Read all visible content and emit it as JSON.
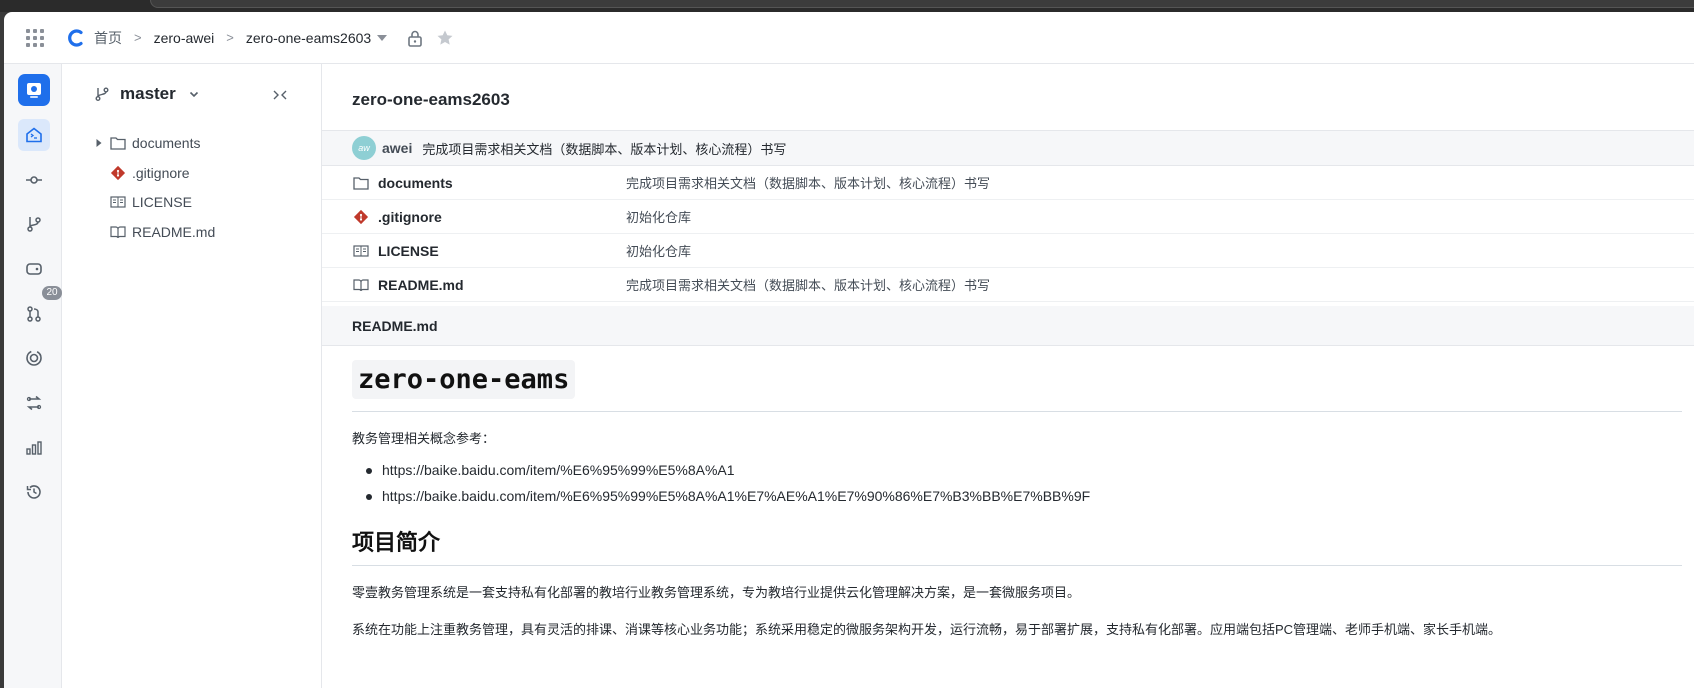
{
  "header": {
    "breadcrumb": {
      "home": "首页",
      "org": "zero-awei",
      "repo": "zero-one-eams2603"
    }
  },
  "rail": {
    "items": [
      {
        "icon": "repo-home-icon",
        "active": true
      },
      {
        "icon": "commits-icon"
      },
      {
        "icon": "branches-icon",
        "badge": "20"
      },
      {
        "icon": "tags-icon"
      },
      {
        "icon": "merge-requests-icon"
      },
      {
        "icon": "pipelines-icon"
      },
      {
        "icon": "compare-icon"
      },
      {
        "icon": "statistics-icon"
      },
      {
        "icon": "history-icon"
      }
    ]
  },
  "tree": {
    "branch": "master",
    "items": [
      {
        "name": "documents",
        "type": "folder"
      },
      {
        "name": ".gitignore",
        "type": "git"
      },
      {
        "name": "LICENSE",
        "type": "license"
      },
      {
        "name": "README.md",
        "type": "readme"
      }
    ]
  },
  "main": {
    "title": "zero-one-eams2603",
    "commit": {
      "avatar": "aw",
      "author": "awei",
      "message": "完成项目需求相关文档（数据脚本、版本计划、核心流程）书写"
    },
    "files": [
      {
        "name": "documents",
        "message": "完成项目需求相关文档（数据脚本、版本计划、核心流程）书写"
      },
      {
        "name": ".gitignore",
        "message": "初始化仓库"
      },
      {
        "name": "LICENSE",
        "message": "初始化仓库"
      },
      {
        "name": "README.md",
        "message": "完成项目需求相关文档（数据脚本、版本计划、核心流程）书写"
      }
    ],
    "readme_label": "README.md",
    "readme": {
      "h1": "zero-one-eams",
      "ref_label": "教务管理相关概念参考：",
      "links": [
        "https://baike.baidu.com/item/%E6%95%99%E5%8A%A1",
        "https://baike.baidu.com/item/%E6%95%99%E5%8A%A1%E7%AE%A1%E7%90%86%E7%B3%BB%E7%BB%9F"
      ],
      "h2": "项目简介",
      "p1": "零壹教务管理系统是一套支持私有化部署的教培行业教务管理系统，专为教培行业提供云化管理解决方案，是一套微服务项目。",
      "p2": "系统在功能上注重教务管理，具有灵活的排课、消课等核心业务功能；系统采用稳定的微服务架构开发，运行流畅，易于部署扩展，支持私有化部署。应用端包括PC管理端、老师手机端、家长手机端。"
    }
  }
}
